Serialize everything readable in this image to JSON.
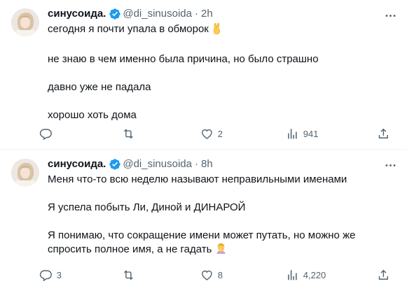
{
  "colors": {
    "text": "#0f1419",
    "secondary": "#536471",
    "verified": "#1d9bf0",
    "divider": "#eff3f4"
  },
  "tweets": [
    {
      "name": "синусоида.",
      "handle": "@di_sinusoida",
      "separator": "·",
      "time": "2h",
      "paragraphs": [
        "сегодня я почти упала в обморок",
        "не знаю в чем именно была причина, но было страшно",
        "давно уже не падала",
        "хорошо хоть дома"
      ],
      "emoji": "victory-hand-emoji",
      "replies": "",
      "reposts": "",
      "likes": "2",
      "views": "941"
    },
    {
      "name": "синусоида.",
      "handle": "@di_sinusoida",
      "separator": "·",
      "time": "8h",
      "paragraphs": [
        "Меня что-то всю неделю называют неправильными именами",
        "Я успела побыть Ли, Диной и ДИНАРОЙ",
        "Я понимаю, что сокращение имени может путать, но можно же спросить полное имя, а не гадать"
      ],
      "emoji": "facepalm-emoji",
      "replies": "3",
      "reposts": "",
      "likes": "8",
      "views": "4,220"
    }
  ],
  "icons": {
    "more": "more-icon",
    "reply": "reply-icon",
    "repost": "repost-icon",
    "like": "like-icon",
    "views": "views-icon",
    "share": "share-icon",
    "verified": "verified-badge-icon"
  }
}
